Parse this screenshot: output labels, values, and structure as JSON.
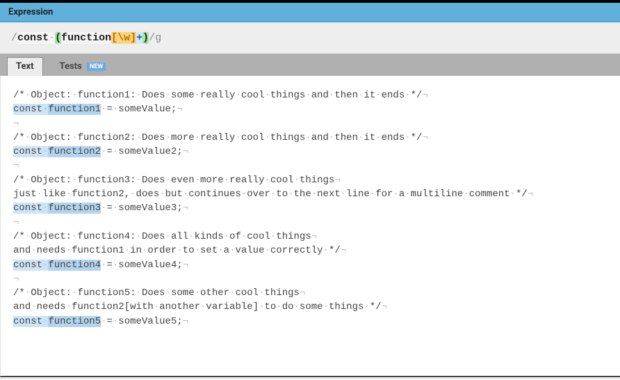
{
  "header": {
    "title": "Expression"
  },
  "expression": {
    "open_delim": "/",
    "literal_part": "const ",
    "group_open": "(",
    "group_literal": "function",
    "charclass": "[\\w]",
    "quantifier": "+",
    "group_close": ")",
    "close_delim": "/",
    "flags": "g"
  },
  "tabs": {
    "text": "Text",
    "tests": "Tests",
    "badge": "NEW"
  },
  "sample": {
    "lines": [
      {
        "t": "comment",
        "text": "/* Object: function1: Does some really cool things and then it ends */"
      },
      {
        "t": "decl",
        "const": "const ",
        "func": "function1",
        "rest": " = someValue;"
      },
      {
        "t": "blank"
      },
      {
        "t": "comment",
        "text": "/* Object: function2: Does more really cool things and then it ends */"
      },
      {
        "t": "decl",
        "const": "const ",
        "func": "function2",
        "rest": " = someValue2;"
      },
      {
        "t": "blank"
      },
      {
        "t": "comment",
        "text": "/* Object: function3: Does even more really cool things"
      },
      {
        "t": "comment",
        "text": "just like function2, does but continues over to the next line for a multiline comment */"
      },
      {
        "t": "decl",
        "const": "const ",
        "func": "function3",
        "rest": " = someValue3;"
      },
      {
        "t": "blank"
      },
      {
        "t": "comment",
        "text": "/* Object: function4: Does all kinds of cool things"
      },
      {
        "t": "comment",
        "text": "and needs function1 in order to set a value correctly */"
      },
      {
        "t": "decl",
        "const": "const ",
        "func": "function4",
        "rest": " = someValue4;"
      },
      {
        "t": "blank"
      },
      {
        "t": "comment",
        "text": "/* Object: function5: Does some other cool things"
      },
      {
        "t": "comment",
        "text": "and needs function2[with another variable] to do some things */"
      },
      {
        "t": "decl",
        "const": "const ",
        "func": "function5",
        "rest": " = someValue5;"
      }
    ]
  },
  "glyphs": {
    "ws": "·",
    "eol": "¬"
  }
}
